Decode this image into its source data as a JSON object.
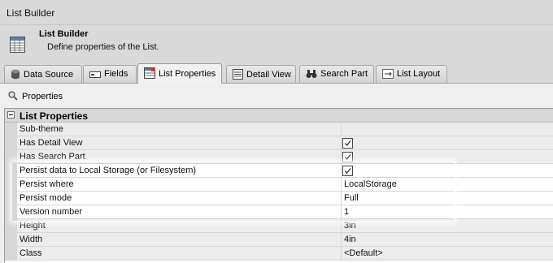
{
  "window": {
    "title": "List Builder"
  },
  "header": {
    "title": "List Builder",
    "description": "Define properties of the List."
  },
  "tabs": [
    {
      "label": "Data Source",
      "icon": "database-icon",
      "active": false
    },
    {
      "label": "Fields",
      "icon": "field-icon",
      "active": false
    },
    {
      "label": "List Properties",
      "icon": "list-properties-icon",
      "active": true
    },
    {
      "label": "Detail View",
      "icon": "detail-view-icon",
      "active": false
    },
    {
      "label": "Search Part",
      "icon": "binoculars-icon",
      "active": false
    },
    {
      "label": "List Layout",
      "icon": "layout-icon",
      "active": false
    }
  ],
  "toolbar": {
    "label": "Properties",
    "icon": "magnifier-icon"
  },
  "grid": {
    "category": "List Properties",
    "rows": [
      {
        "name": "Sub-theme",
        "value": "",
        "checkbox": false
      },
      {
        "name": "Has Detail View",
        "value": "",
        "checkbox": true
      },
      {
        "name": "Has Search Part",
        "value": "",
        "checkbox": true
      },
      {
        "name": "Persist data to Local Storage (or Filesystem)",
        "value": "",
        "checkbox": true
      },
      {
        "name": "Persist where",
        "value": "LocalStorage",
        "checkbox": false
      },
      {
        "name": "Persist mode",
        "value": "Full",
        "checkbox": false
      },
      {
        "name": "Version number",
        "value": "1",
        "checkbox": false
      },
      {
        "name": "Height",
        "value": "3in",
        "checkbox": false
      },
      {
        "name": "Width",
        "value": "4in",
        "checkbox": false
      },
      {
        "name": "Class",
        "value": "<Default>",
        "checkbox": false
      }
    ]
  },
  "colors": {
    "background": "#d9d9d9",
    "panel": "#efefef",
    "category_bar": "#d7d7d7",
    "highlight": "#ffffff"
  }
}
